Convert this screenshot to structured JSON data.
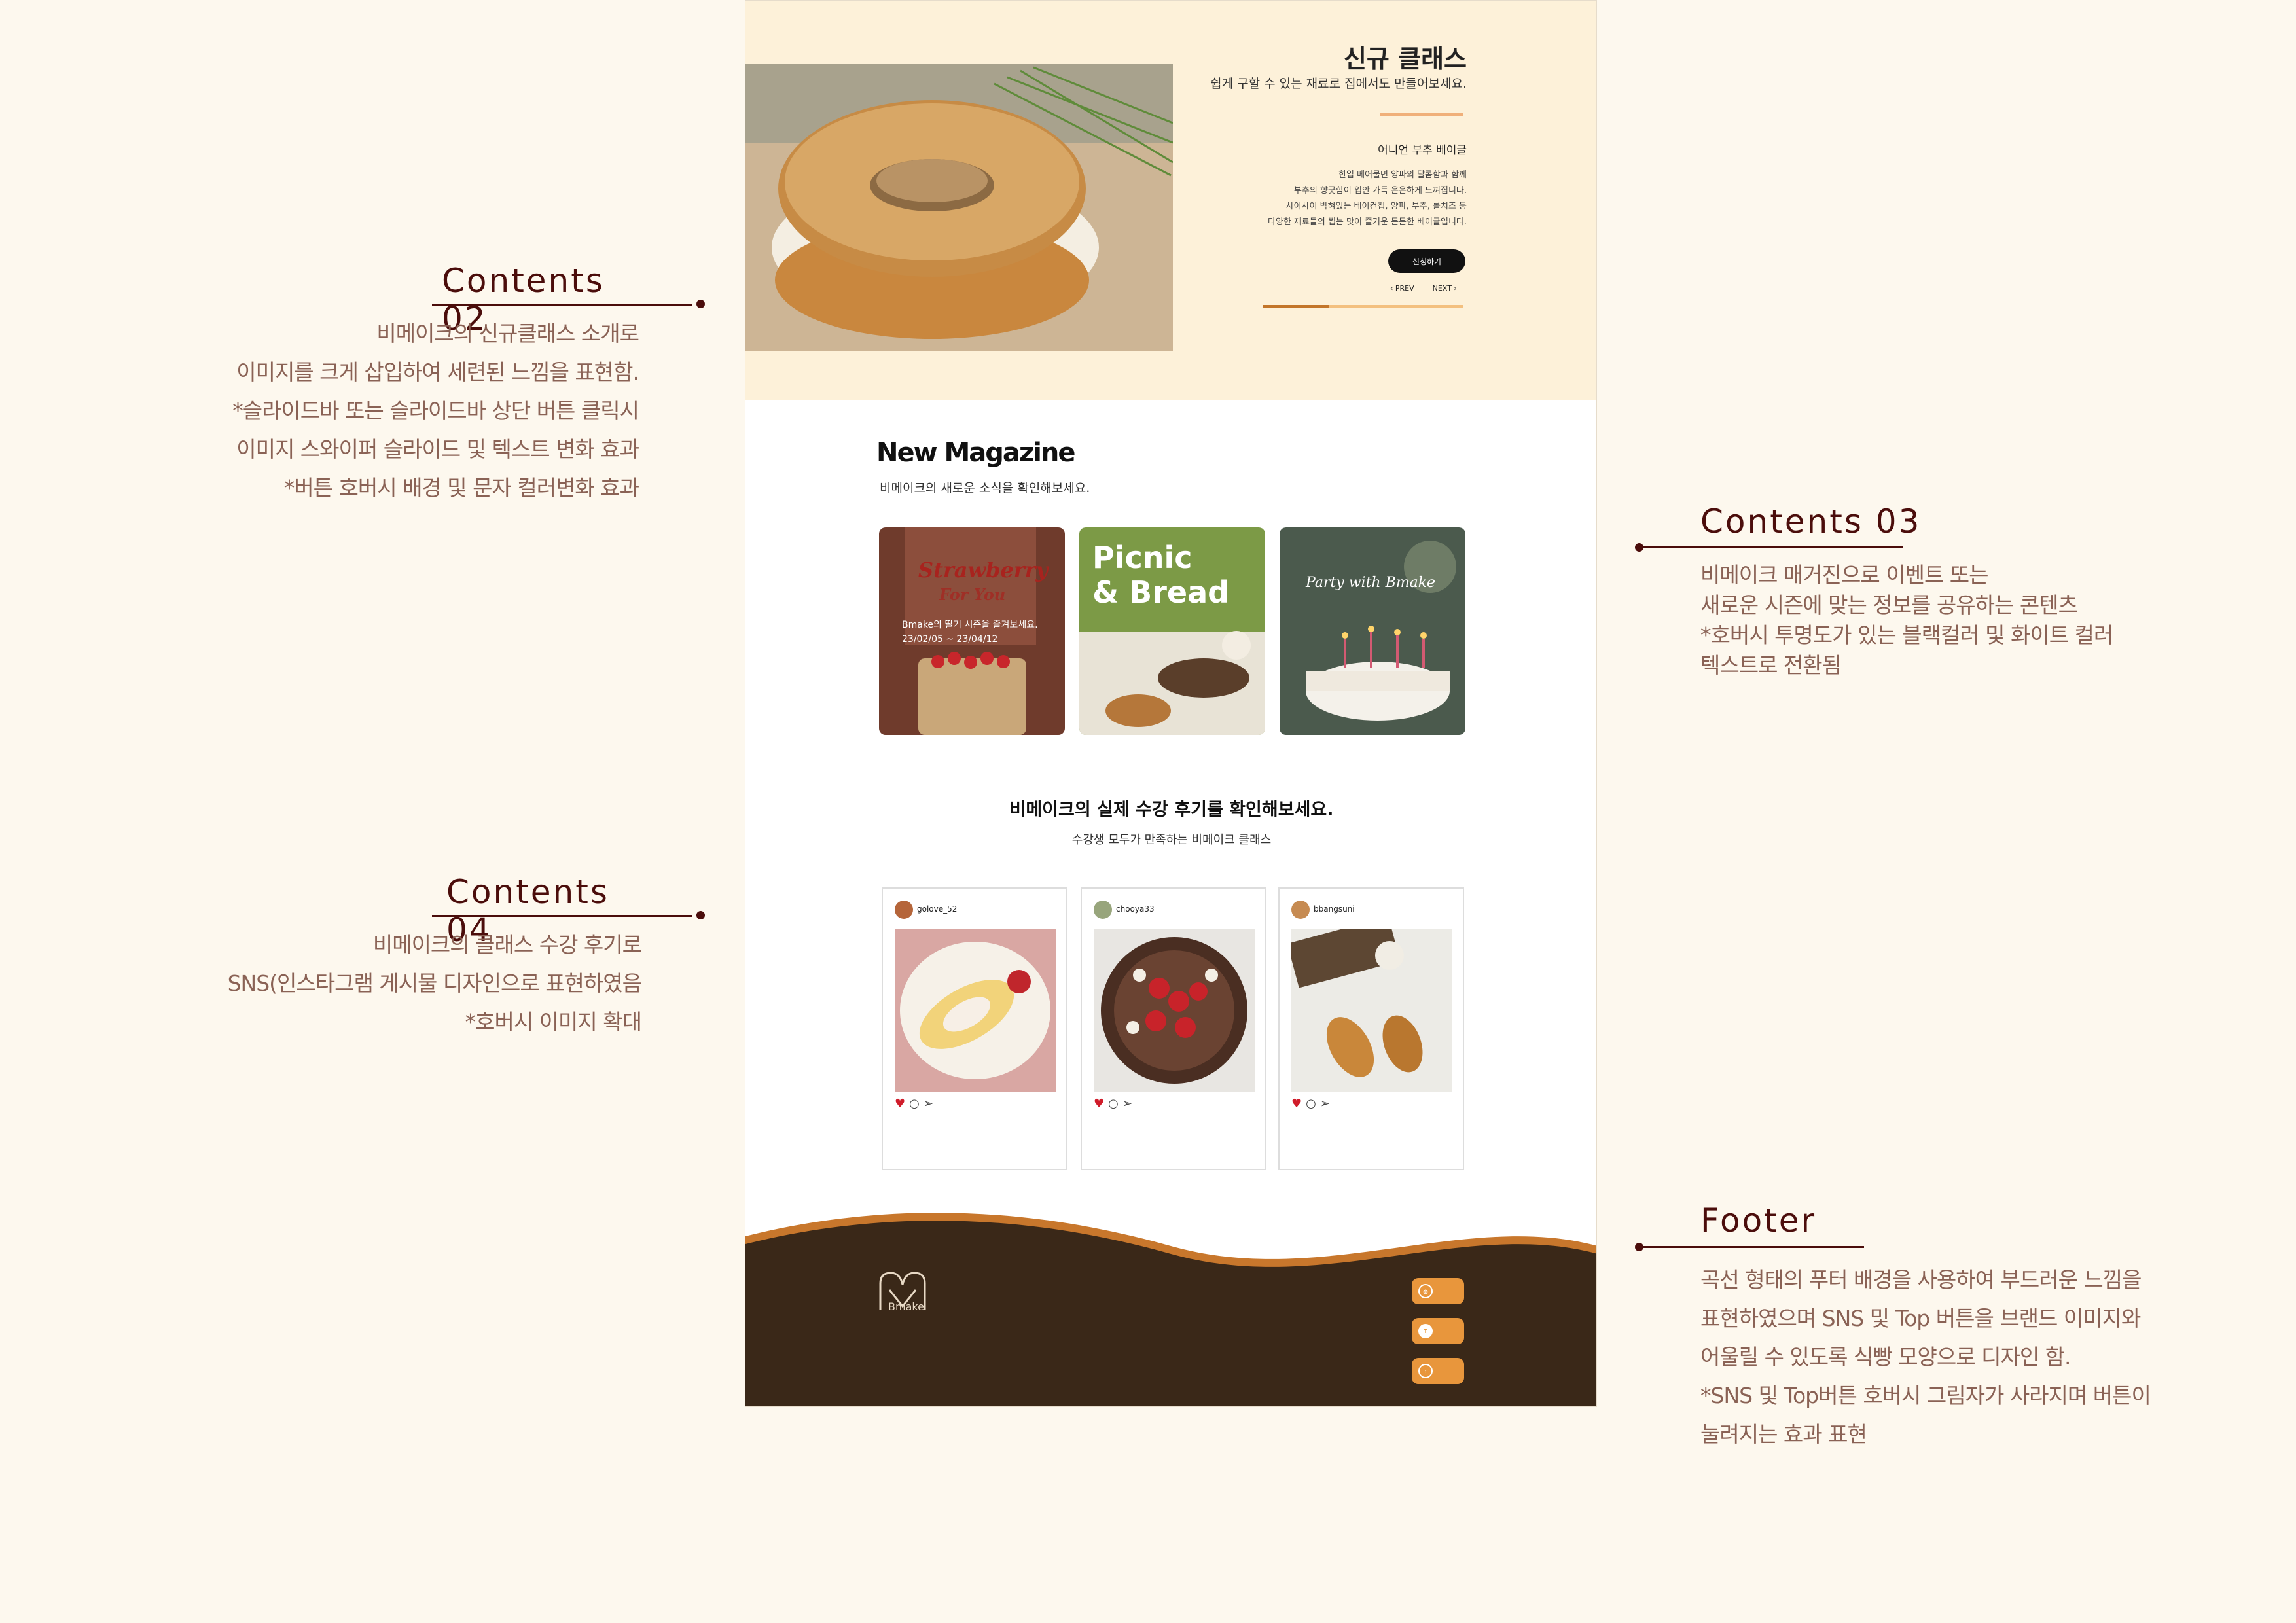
{
  "annotations": {
    "c02": {
      "title": "Contents 02",
      "lines": [
        "비메이크의 신규클래스 소개로",
        "이미지를 크게 삽입하여 세련된 느낌을 표현함.",
        "*슬라이드바 또는 슬라이드바 상단 버튼 클릭시",
        "이미지 스와이퍼 슬라이드 및 텍스트 변화 효과",
        "*버튼 호버시 배경 및 문자 컬러변화 효과"
      ]
    },
    "c03": {
      "title": "Contents 03",
      "lines": [
        "비메이크 매거진으로 이벤트 또는",
        "새로운 시즌에 맞는 정보를 공유하는 콘텐츠",
        "*호버시 투명도가 있는 블랙컬러 및 화이트 컬러",
        "텍스트로 전환됨"
      ]
    },
    "c04": {
      "title": "Contents 04",
      "lines": [
        "비메이크의 클래스 수강 후기로",
        "SNS(인스타그램 게시물 디자인으로 표현하였음",
        "*호버시 이미지 확대"
      ]
    },
    "footer": {
      "title": "Footer",
      "lines": [
        "곡선 형태의 푸터 배경을 사용하여 부드러운 느낌을",
        "표현하였으며 SNS 및 Top 버튼을 브랜드 이미지와",
        "어울릴 수 있도록 식빵 모양으로 디자인 함.",
        "*SNS 및 Top버튼 호버시 그림자가 사라지며 버튼이",
        "눌려지는 효과 표현"
      ]
    }
  },
  "hero": {
    "title": "신규 클래스",
    "subtitle": "쉽게 구할 수 있는 재료로 집에서도 만들어보세요.",
    "item": "어니언 부추 베이글",
    "desc": [
      "한입 베어물면 양파의 달콤함과 함께",
      "부추의 향긋함이 입안 가득 은은하게 느껴집니다.",
      "사이사이 박혀있는 베이컨칩, 양파, 부추, 롤치즈 등",
      "다양한 재료들의 씹는 맛이 즐거운 든든한 베이글입니다."
    ],
    "button": "신청하기",
    "prev": "PREV",
    "next": "NEXT",
    "progress": 0.33,
    "image_icon": "bagel-photo"
  },
  "magazine": {
    "title": "New Magazine",
    "subtitle": "비메이크의 새로운 소식을 확인해보세요.",
    "cards": [
      {
        "heading": "Strawberry",
        "heading2": "For You",
        "text1": "Bmake의 딸기 시즌을 즐겨보세요.",
        "text2": "23/02/05 ~ 23/04/12"
      },
      {
        "heading": "Picnic",
        "heading2": "& Bread",
        "text1": "",
        "text2": ""
      },
      {
        "heading": "Party with Bmake",
        "heading2": "",
        "text1": "",
        "text2": ""
      }
    ]
  },
  "reviews": {
    "title": "비메이크의 실제 수강 후기를 확인해보세요.",
    "subtitle": "수강생 모두가 만족하는 비메이크 클래스",
    "posts": [
      {
        "user": "golove_52",
        "likes": "",
        "caption": "",
        "tags": ""
      },
      {
        "user": "chooya33",
        "likes": "",
        "caption": "",
        "tags": ""
      },
      {
        "user": "bbangsuni",
        "likes": "",
        "caption": "",
        "tags": ""
      }
    ]
  },
  "footer": {
    "brand": "Bmake",
    "info_left": [],
    "info_right": [],
    "buttons": [
      {
        "icon": "instagram-icon",
        "label": ""
      },
      {
        "icon": "talk-icon",
        "label": ""
      },
      {
        "icon": "top-icon",
        "label": ""
      }
    ]
  },
  "colors": {
    "accent": "#4b0d0b",
    "footer_bg": "#3a2818",
    "footer_wave": "#c8772c",
    "button_orange": "#e8963c"
  }
}
